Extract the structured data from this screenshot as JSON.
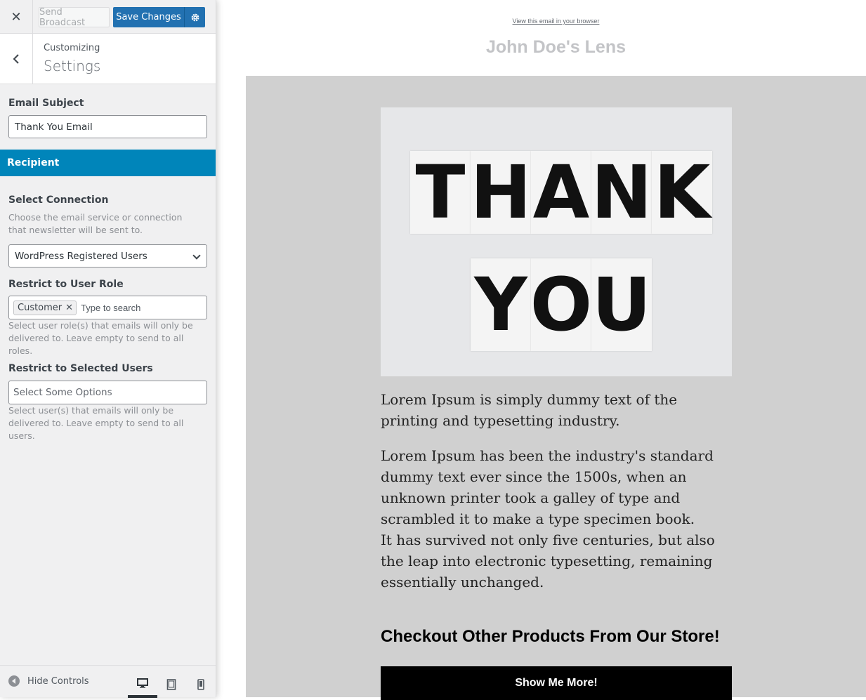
{
  "toolbar": {
    "close_icon": "close-icon",
    "send_label": "Send Broadcast",
    "save_label": "Save Changes",
    "gear_icon": "gear-icon"
  },
  "panel": {
    "breadcrumb": "Customizing",
    "title": "Settings"
  },
  "form": {
    "email_subject_label": "Email Subject",
    "email_subject_value": "Thank You Email",
    "section_title": "Recipient",
    "connection_label": "Select Connection",
    "connection_desc": "Choose the email service or connection that newsletter will be sent to.",
    "connection_value": "WordPress Registered Users",
    "role_label": "Restrict to User Role",
    "role_tag": "Customer",
    "role_placeholder": "Type to search",
    "role_desc": "Select user role(s) that emails will only be delivered to. Leave empty to send to all roles.",
    "users_label": "Restrict to Selected Users",
    "users_placeholder": "Select Some Options",
    "users_desc": "Select user(s) that emails will only be delivered to. Leave empty to send to all users."
  },
  "footer": {
    "hide_controls": "Hide Controls",
    "devices": [
      "desktop",
      "tablet",
      "mobile"
    ],
    "active_device": "desktop"
  },
  "email": {
    "view_in_browser": "View this email in your browser",
    "store_name": "John Doe's Lens",
    "hero_line1": [
      "T",
      "H",
      "A",
      "N",
      "K"
    ],
    "hero_line2": [
      "Y",
      "O",
      "U"
    ],
    "paragraph1": "Lorem Ipsum is simply dummy text of the printing and typesetting industry.",
    "paragraph2a": "Lorem Ipsum has been the industry's standard dummy text ever since the 1500s, when an unknown printer took a galley of type and scrambled it to make a type specimen book.",
    "paragraph2b": "It has survived not only five centuries, but also the leap into electronic typesetting, remaining essentially unchanged.",
    "cta_heading": "Checkout Other Products From Our Store!",
    "cta_button": "Show Me More!"
  },
  "colors": {
    "accent": "#2271b1",
    "section": "#0085ba",
    "preview_bg": "#d0d0d0"
  }
}
